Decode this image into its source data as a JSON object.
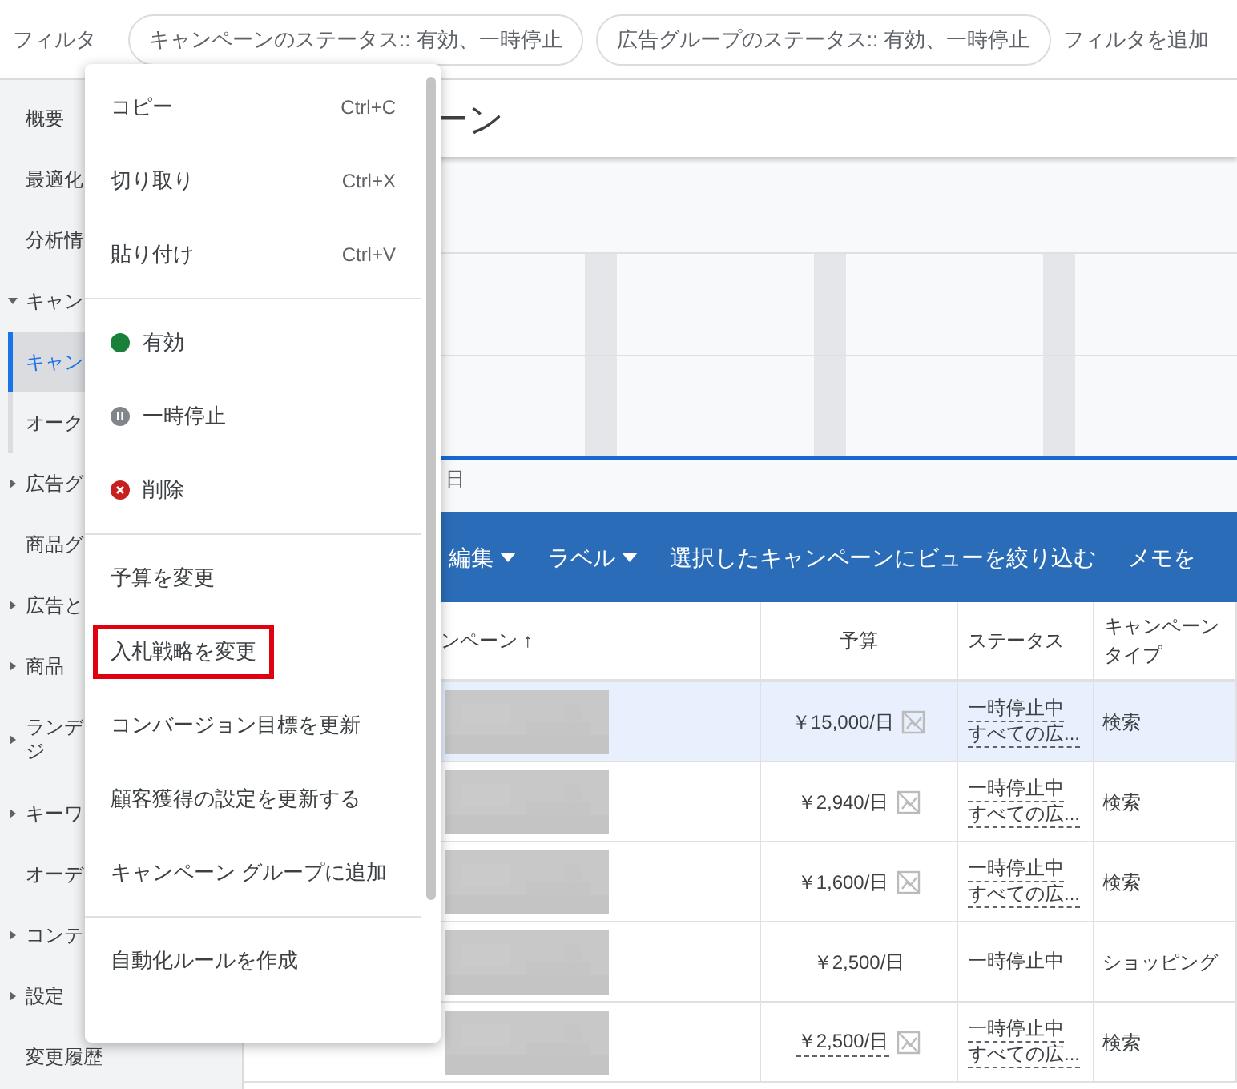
{
  "filter_bar": {
    "label": "フィルタ",
    "chips": [
      "キャンペーンのステータス:: 有効、一時停止",
      "広告グループのステータス:: 有効、一時停止"
    ],
    "add": "フィルタを追加"
  },
  "sidebar": {
    "items": [
      {
        "label": "概要",
        "selected": false
      },
      {
        "label": "最適化",
        "selected": false
      },
      {
        "label": "分析情",
        "selected": false
      },
      {
        "label": "キャン",
        "expanded": true,
        "selected": false,
        "children": [
          {
            "label": "キャン",
            "selected": true
          },
          {
            "label": "オーク",
            "selected": false
          }
        ]
      },
      {
        "label": "広告グ",
        "expanded": false,
        "selected": false
      },
      {
        "label": "商品グ",
        "selected": false
      },
      {
        "label": "広告と",
        "expanded": false,
        "selected": false
      },
      {
        "label": "商品",
        "expanded": false,
        "selected": false
      },
      {
        "label": "ランデジ",
        "expanded": false,
        "selected": false
      },
      {
        "label": "キーワ",
        "expanded": false,
        "selected": false
      },
      {
        "label": "オーデ",
        "selected": false
      },
      {
        "label": "コンテ",
        "expanded": false,
        "selected": false
      },
      {
        "label": "設定",
        "expanded": false,
        "selected": false
      },
      {
        "label": "変更履歴",
        "selected": false
      }
    ]
  },
  "page_title": "ーン",
  "chart": {
    "date_label": "日"
  },
  "toolbar": [
    {
      "label": "編集",
      "dropdown": true
    },
    {
      "label": "ラベル",
      "dropdown": true
    },
    {
      "label": "選択したキャンペーンにビューを絞り込む",
      "dropdown": false
    },
    {
      "label": "メモを",
      "dropdown": false
    }
  ],
  "table": {
    "columns": [
      "ンペーン ↑",
      "予算",
      "ステータス",
      "キャンペーンタイプ"
    ],
    "rows": [
      {
        "selected": true,
        "budget": "￥15,000/日",
        "budget_underlined": false,
        "budget_icon": true,
        "status": "一時停止中",
        "status_detail": "すべての広...",
        "type": "検索"
      },
      {
        "selected": false,
        "budget": "￥2,940/日",
        "budget_underlined": false,
        "budget_icon": true,
        "status": "一時停止中",
        "status_detail": "すべての広...",
        "type": "検索"
      },
      {
        "selected": false,
        "budget": "￥1,600/日",
        "budget_underlined": false,
        "budget_icon": true,
        "status": "一時停止中",
        "status_detail": "すべての広...",
        "type": "検索"
      },
      {
        "selected": false,
        "budget": "￥2,500/日",
        "budget_underlined": false,
        "budget_icon": false,
        "status": "一時停止中",
        "type": "ショッピング"
      },
      {
        "selected": false,
        "budget": "￥2,500/日",
        "budget_underlined": true,
        "budget_icon": true,
        "status": "一時停止中",
        "status_detail": "すべての広...",
        "type": "検索"
      }
    ]
  },
  "context_menu": {
    "groups": [
      [
        {
          "kind": "plain",
          "label": "コピー",
          "shortcut": "Ctrl+C",
          "highlighted": false
        },
        {
          "kind": "plain",
          "label": "切り取り",
          "shortcut": "Ctrl+X",
          "highlighted": false
        },
        {
          "kind": "plain",
          "label": "貼り付け",
          "shortcut": "Ctrl+V",
          "highlighted": false
        }
      ],
      [
        {
          "kind": "status",
          "label": "有効",
          "color": "#188038",
          "highlighted": false
        },
        {
          "kind": "pause",
          "label": "一時停止",
          "color": "#80868b",
          "highlighted": false
        },
        {
          "kind": "remove",
          "label": "削除",
          "color": "#c5221f",
          "highlighted": false
        }
      ],
      [
        {
          "kind": "plain",
          "label": "予算を変更",
          "highlighted": false
        },
        {
          "kind": "plain",
          "label": "入札戦略を変更",
          "highlighted": true
        },
        {
          "kind": "plain",
          "label": "コンバージョン目標を更新",
          "highlighted": false
        },
        {
          "kind": "plain",
          "label": "顧客獲得の設定を更新する",
          "highlighted": false
        },
        {
          "kind": "plain",
          "label": "キャンペーン グループに追加",
          "highlighted": false
        }
      ],
      [
        {
          "kind": "plain",
          "label": "自動化ルールを作成",
          "highlighted": false
        }
      ]
    ]
  }
}
